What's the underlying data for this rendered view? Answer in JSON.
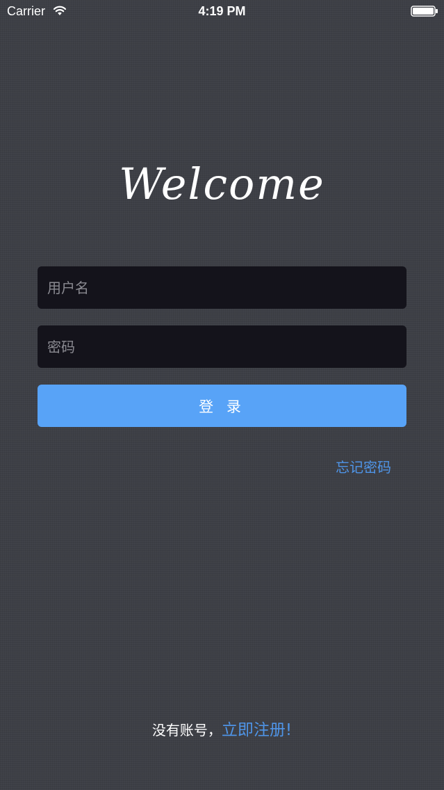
{
  "status_bar": {
    "carrier": "Carrier",
    "time": "4:19 PM",
    "wifi_icon": "wifi-icon",
    "battery_icon": "battery-icon"
  },
  "title": "Welcome",
  "form": {
    "username_placeholder": "用户名",
    "username_value": "",
    "password_placeholder": "密码",
    "password_value": "",
    "login_label": "登 录",
    "forgot_password_label": "忘记密码"
  },
  "footer": {
    "no_account_text": "没有账号，",
    "register_label": "立即注册!"
  },
  "colors": {
    "background": "#3d3f46",
    "input_background": "#14131b",
    "button_background": "#58a3f7",
    "link": "#4f95e8"
  }
}
